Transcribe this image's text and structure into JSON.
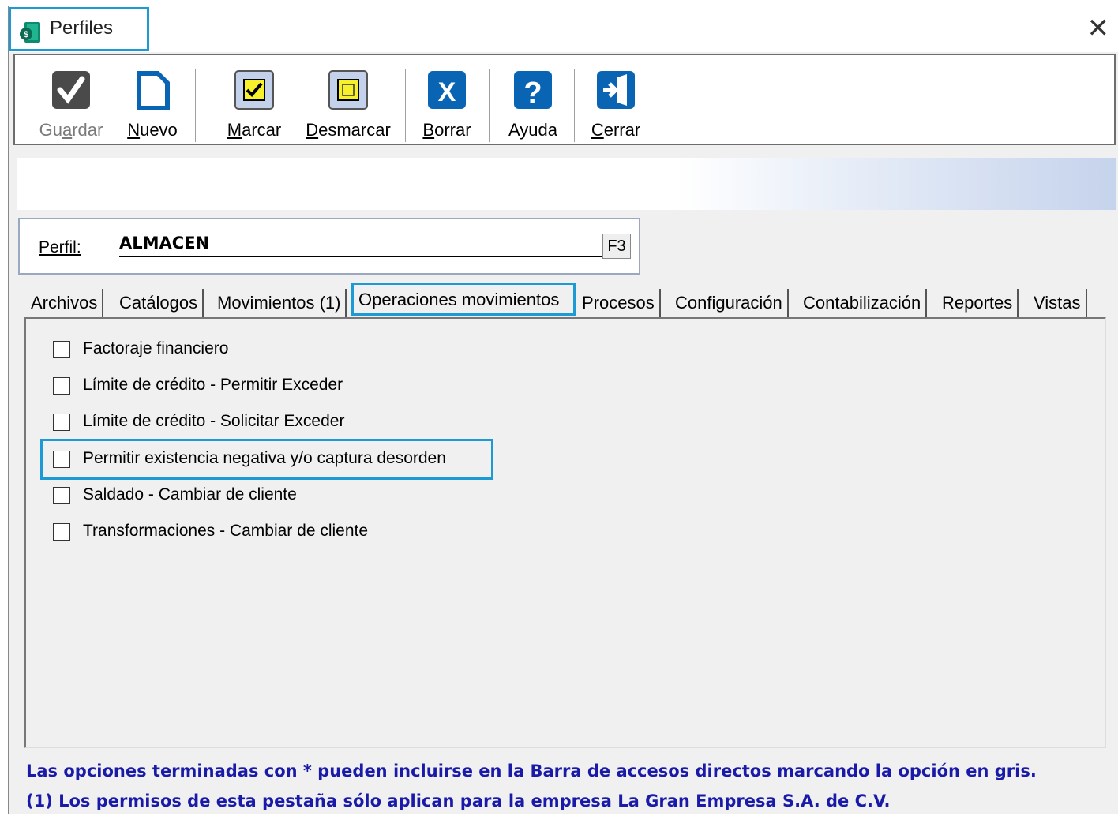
{
  "window": {
    "title": "Perfiles",
    "close_glyph": "✕"
  },
  "toolbar": {
    "buttons": [
      {
        "label": "Guardar",
        "accel_index": 2,
        "icon": "check-icon",
        "enabled": false
      },
      {
        "label": "Nuevo",
        "accel_index": 0,
        "icon": "document-icon",
        "enabled": true
      },
      {
        "label": "Marcar",
        "accel_index": 0,
        "icon": "checkbox-marked-icon",
        "enabled": true
      },
      {
        "label": "Desmarcar",
        "accel_index": 0,
        "icon": "checkbox-unmarked-icon",
        "enabled": true
      },
      {
        "label": "Borrar",
        "accel_index": 0,
        "icon": "delete-x-icon",
        "enabled": true
      },
      {
        "label": "Ayuda",
        "accel_index": -1,
        "icon": "help-icon",
        "enabled": true
      },
      {
        "label": "Cerrar",
        "accel_index": 0,
        "icon": "exit-door-icon",
        "enabled": true
      }
    ]
  },
  "perfil": {
    "label": "Perfil:",
    "value": "ALMACEN",
    "lookup_button": "F3"
  },
  "tabs": [
    {
      "label": "Archivos",
      "active": false
    },
    {
      "label": "Catálogos",
      "active": false
    },
    {
      "label": "Movimientos (1)",
      "active": false
    },
    {
      "label": "Operaciones movimientos",
      "active": true
    },
    {
      "label": "Procesos",
      "active": false
    },
    {
      "label": "Configuración",
      "active": false
    },
    {
      "label": "Contabilización",
      "active": false
    },
    {
      "label": "Reportes",
      "active": false
    },
    {
      "label": "Vistas",
      "active": false
    }
  ],
  "options": [
    {
      "label": "Factoraje financiero",
      "checked": false
    },
    {
      "label": "Límite de crédito - Permitir Exceder",
      "checked": false
    },
    {
      "label": "Límite de crédito - Solicitar Exceder",
      "checked": false
    },
    {
      "label": "Permitir existencia negativa y/o captura desorden",
      "checked": false,
      "highlighted": true
    },
    {
      "label": "Saldado - Cambiar de cliente",
      "checked": false
    },
    {
      "label": "Transformaciones - Cambiar de cliente",
      "checked": false
    }
  ],
  "notes": [
    "Las opciones terminadas con * pueden incluirse en la Barra de accesos directos marcando la opción en gris.",
    "(1) Los permisos de esta pestaña sólo aplican para la empresa La Gran Empresa S.A. de C.V."
  ],
  "colors": {
    "highlight": "#1b9ad6",
    "notes_text": "#1a1aa8",
    "icon_blue": "#0a64b4"
  }
}
